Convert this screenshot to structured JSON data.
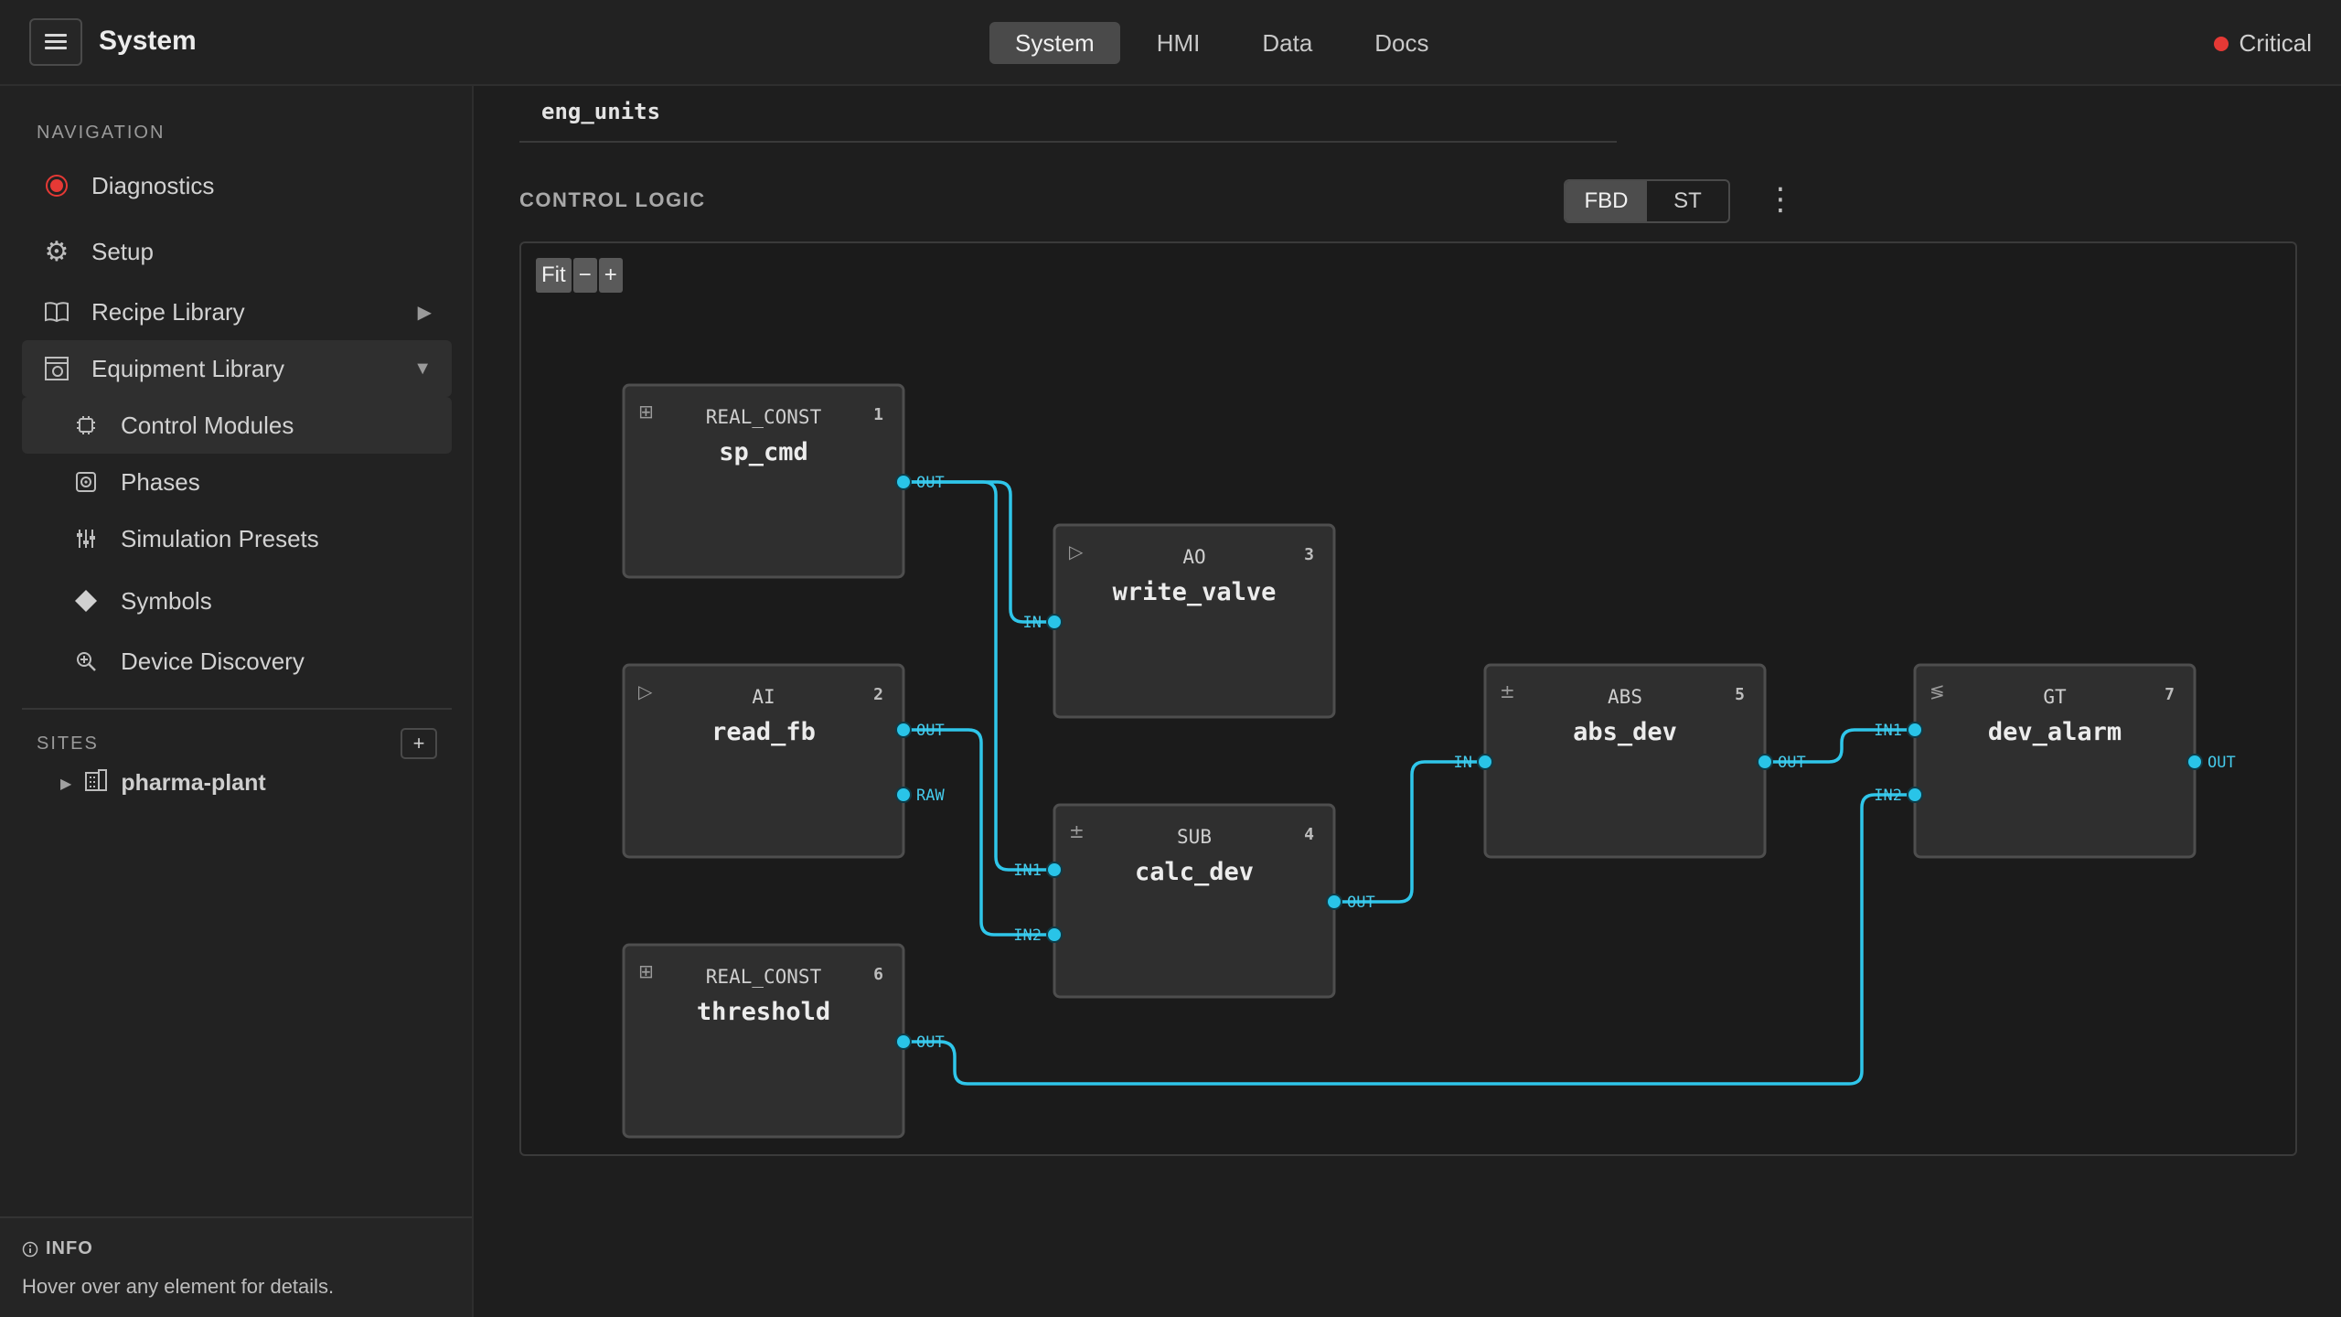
{
  "header": {
    "title": "System",
    "tabs": [
      "System",
      "HMI",
      "Data",
      "Docs"
    ],
    "active_tab": "System",
    "status": {
      "label": "Critical",
      "color": "#e53935"
    }
  },
  "sidebar": {
    "nav_heading": "NAVIGATION",
    "items": [
      {
        "label": "Diagnostics",
        "icon": "record-icon"
      },
      {
        "label": "Setup",
        "icon": "gear-icon"
      },
      {
        "label": "Recipe Library",
        "icon": "book-icon",
        "caret": "▶"
      },
      {
        "label": "Equipment Library",
        "icon": "equipment-icon",
        "caret": "▼"
      }
    ],
    "sub_items": [
      {
        "label": "Control Modules",
        "icon": "chip-icon"
      },
      {
        "label": "Phases",
        "icon": "phase-icon"
      },
      {
        "label": "Simulation Presets",
        "icon": "sliders-icon"
      },
      {
        "label": "Symbols",
        "icon": "diamond-icon"
      },
      {
        "label": "Device Discovery",
        "icon": "discovery-icon"
      }
    ],
    "sites_heading": "SITES",
    "sites_add": "+",
    "site": {
      "label": "pharma-plant",
      "icon": "building-icon"
    }
  },
  "info": {
    "title": "INFO",
    "text": "Hover over any element for details."
  },
  "main": {
    "field_label": "eng_units",
    "section_label": "CONTROL LOGIC",
    "modes": [
      "FBD",
      "ST"
    ],
    "active_mode": "FBD",
    "menu": "⋮",
    "zoom": {
      "fit": "Fit",
      "minus": "−",
      "plus": "+"
    }
  },
  "fbd": {
    "wire_color": "#2fc6ea",
    "blocks": [
      {
        "id": 1,
        "type": "REAL_CONST",
        "name": "sp_cmd",
        "icon": "const-icon",
        "inputs": [],
        "outputs": [
          "OUT"
        ]
      },
      {
        "id": 2,
        "type": "AI",
        "name": "read_fb",
        "icon": "play-icon",
        "inputs": [],
        "outputs": [
          "OUT",
          "RAW"
        ]
      },
      {
        "id": 3,
        "type": "AO",
        "name": "write_valve",
        "icon": "play-icon",
        "inputs": [
          "IN"
        ],
        "outputs": []
      },
      {
        "id": 4,
        "type": "SUB",
        "name": "calc_dev",
        "icon": "plusminus-icon",
        "inputs": [
          "IN1",
          "IN2"
        ],
        "outputs": [
          "OUT"
        ]
      },
      {
        "id": 5,
        "type": "ABS",
        "name": "abs_dev",
        "icon": "plusminus-icon",
        "inputs": [
          "IN"
        ],
        "outputs": [
          "OUT"
        ]
      },
      {
        "id": 6,
        "type": "REAL_CONST",
        "name": "threshold",
        "icon": "const-icon",
        "inputs": [],
        "outputs": [
          "OUT"
        ]
      },
      {
        "id": 7,
        "type": "GT",
        "name": "dev_alarm",
        "icon": "compare-icon",
        "inputs": [
          "IN1",
          "IN2"
        ],
        "outputs": [
          "OUT"
        ]
      }
    ],
    "connections": [
      {
        "from": "sp_cmd.OUT",
        "to": "write_valve.IN"
      },
      {
        "from": "sp_cmd.OUT",
        "to": "calc_dev.IN1"
      },
      {
        "from": "read_fb.OUT",
        "to": "calc_dev.IN2"
      },
      {
        "from": "calc_dev.OUT",
        "to": "abs_dev.IN"
      },
      {
        "from": "abs_dev.OUT",
        "to": "dev_alarm.IN1"
      },
      {
        "from": "threshold.OUT",
        "to": "dev_alarm.IN2"
      }
    ]
  }
}
